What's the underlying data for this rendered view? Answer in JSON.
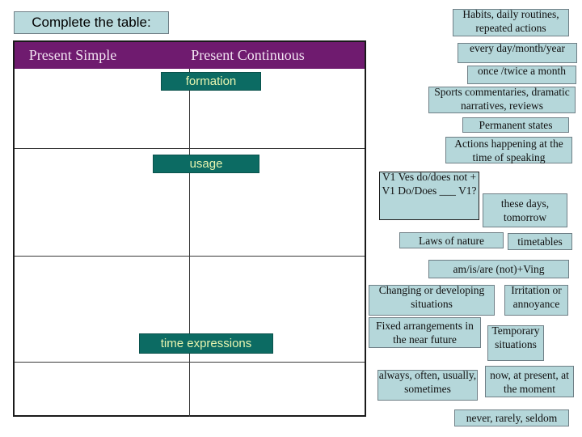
{
  "prompt": {
    "label": "Complete the table:"
  },
  "table": {
    "columns": [
      "Present Simple",
      "Present Continuous"
    ],
    "row_labels": [
      "formation",
      "usage",
      "time expressions"
    ],
    "header_bg": "#6f1b6f",
    "label_bg": "#0c6b63",
    "label_color": "#e8f5b0"
  },
  "answer_boxes": [
    {
      "id": "habits",
      "text": "Habits, daily routines, repeated actions"
    },
    {
      "id": "every",
      "text": "every day/month/year"
    },
    {
      "id": "once",
      "text": "once /twice a month"
    },
    {
      "id": "sports",
      "text": "Sports commentaries, dramatic narratives, reviews"
    },
    {
      "id": "permanent",
      "text": "Permanent states"
    },
    {
      "id": "actions",
      "text": "Actions happening at the time of speaking"
    },
    {
      "id": "formation_ps",
      "text": "V1  Ves do/does not + V1 Do/Does ___ V1?"
    },
    {
      "id": "these_days",
      "text": "these days, tomorrow"
    },
    {
      "id": "laws",
      "text": "Laws of nature"
    },
    {
      "id": "timetables",
      "text": "timetables"
    },
    {
      "id": "am_is_are",
      "text": "am/is/are (not)+Ving"
    },
    {
      "id": "changing",
      "text": "Changing or developing situations"
    },
    {
      "id": "irritation",
      "text": "Irritation or annoyance"
    },
    {
      "id": "fixed",
      "text": "Fixed arrangements in the near future"
    },
    {
      "id": "temporary",
      "text": "Temporary situations"
    },
    {
      "id": "always",
      "text": "always, often, usually, sometimes"
    },
    {
      "id": "now",
      "text": "now, at present, at the moment"
    },
    {
      "id": "never",
      "text": "never, rarely, seldom"
    }
  ],
  "box_colors": {
    "answer_bg": "#b5d7da",
    "answer_border": "#6f7f86"
  }
}
